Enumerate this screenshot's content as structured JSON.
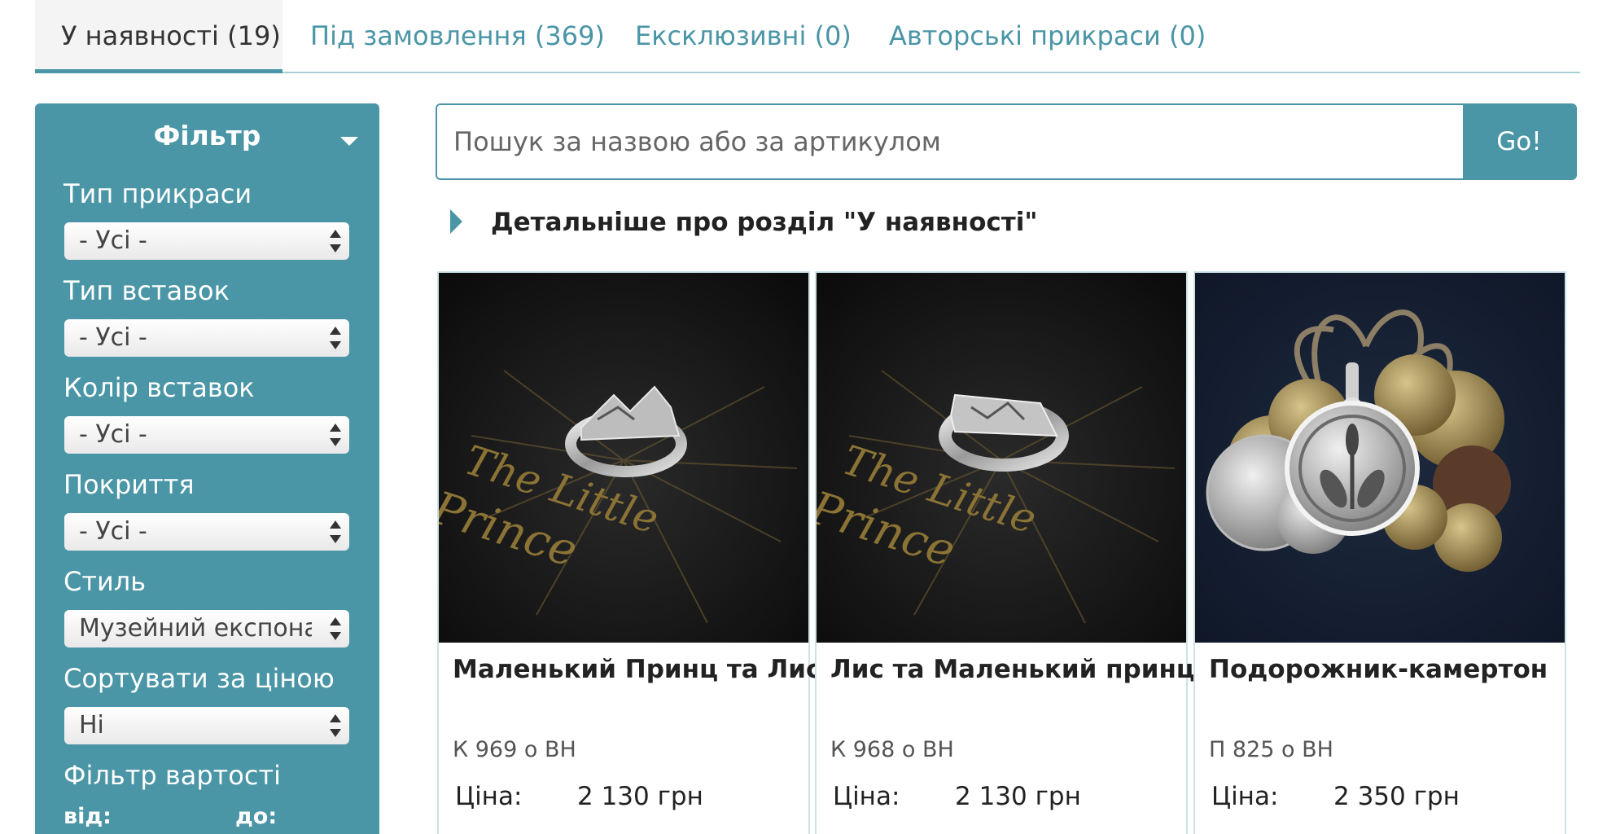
{
  "tabs": [
    {
      "label": "У наявності (19)"
    },
    {
      "label": "Під замовлення (369)"
    },
    {
      "label": "Ексклюзивні (0)"
    },
    {
      "label": "Авторські прикраси (0)"
    }
  ],
  "filter": {
    "title": "Фільтр",
    "groups": [
      {
        "label": "Тип прикраси",
        "value": "- Усі -"
      },
      {
        "label": "Тип вставок",
        "value": "- Усі -"
      },
      {
        "label": "Колір вставок",
        "value": "- Усі -"
      },
      {
        "label": "Покриття",
        "value": "- Усі -"
      },
      {
        "label": "Стиль",
        "value": "Музейний експонат"
      },
      {
        "label": "Сортувати за ціною",
        "value": "Ні"
      }
    ],
    "price_filter_label": "Фільтр вартості",
    "from_label": "від:",
    "to_label": "до:"
  },
  "search": {
    "placeholder": "Пошук за назвою або за артикулом",
    "button_label": "Go!"
  },
  "details_link": "Детальніше про розділ \"У наявності\"",
  "products": [
    {
      "title": "Маленький Принц та Лис",
      "sku": "К 969 о ВН",
      "price_label": "Ціна:",
      "price": "2 130 грн",
      "image": "silver-ring-photo"
    },
    {
      "title": "Лис та Маленький принц",
      "sku": "К 968 о ВН",
      "price_label": "Ціна:",
      "price": "2 130 грн",
      "image": "silver-ring-photo"
    },
    {
      "title": "Подорожник-камертон",
      "sku": "П 825 о ВН",
      "price_label": "Ціна:",
      "price": "2 350 грн",
      "image": "pendant-with-coins-photo"
    }
  ],
  "colors": {
    "accent": "#4a95a6",
    "tab_border": "#a9cfd6",
    "card_border": "#cde2e6"
  }
}
